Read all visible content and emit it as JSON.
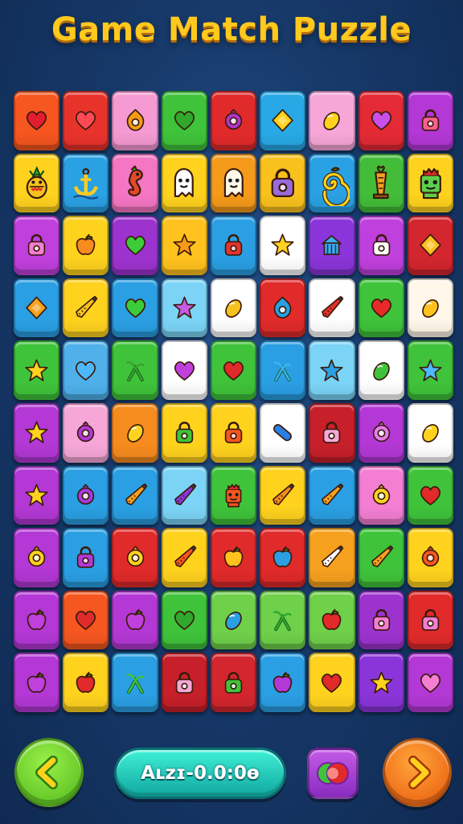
{
  "title": "Game Match Puzzle",
  "board": {
    "rows": [
      [
        {
          "color": "#f6561f",
          "icon": "heart",
          "fg": "#e21d2e"
        },
        {
          "color": "#e8332b",
          "icon": "heart",
          "fg": "#ff4a55"
        },
        {
          "color": "#f59ad2",
          "icon": "ring-flame",
          "fg": "#f49a15"
        },
        {
          "color": "#3fc33a",
          "icon": "heart",
          "fg": "#2fa82d"
        },
        {
          "color": "#e12a2a",
          "icon": "ring",
          "fg": "#b035c9"
        },
        {
          "color": "#28a9e5",
          "icon": "diamond",
          "fg": "#ffd21e"
        },
        {
          "color": "#f6a7d8",
          "icon": "lemon",
          "fg": "#ffd21e"
        },
        {
          "color": "#e32a35",
          "icon": "heart",
          "fg": "#c94fe8"
        },
        {
          "color": "#b338d5",
          "icon": "lock",
          "fg": "#ff5f8e"
        }
      ],
      [
        {
          "color": "#ffd21e",
          "icon": "pineapple",
          "fg": "#4caf50",
          "tall": true
        },
        {
          "color": "#2aa1e3",
          "icon": "anchor",
          "fg": "#ffcc1e",
          "tall": true
        },
        {
          "color": "#f576c2",
          "icon": "seahorse",
          "fg": "#e24a2a",
          "tall": true
        },
        {
          "color": "#ffd21e",
          "icon": "ghost",
          "fg": "#ffffff",
          "tall": true
        },
        {
          "color": "#f59a1a",
          "icon": "ghost",
          "fg": "#fff7e8",
          "tall": true
        },
        {
          "color": "#f9c11e",
          "icon": "lock",
          "fg": "#9a6ad8",
          "tall": true
        },
        {
          "color": "#2aa1e3",
          "icon": "spiral",
          "fg": "#ffd21e",
          "tall": true
        },
        {
          "color": "#43bd39",
          "icon": "torch",
          "fg": "#f6a11e",
          "tall": true
        },
        {
          "color": "#ffd21e",
          "icon": "robot",
          "fg": "#5dcf4a",
          "tall": true
        }
      ],
      [
        {
          "color": "#c040dd",
          "icon": "lock",
          "fg": "#f47ed2"
        },
        {
          "color": "#ffd21e",
          "icon": "apple",
          "fg": "#f68b1e"
        },
        {
          "color": "#9d33cf",
          "icon": "heart",
          "fg": "#3ccc3a"
        },
        {
          "color": "#ffc21e",
          "icon": "star",
          "fg": "#f79a1a"
        },
        {
          "color": "#2a9fe3",
          "icon": "lock",
          "fg": "#e6332b"
        },
        {
          "color": "#ffffff",
          "icon": "star",
          "fg": "#ffd21e"
        },
        {
          "color": "#8a35d9",
          "icon": "house",
          "fg": "#3ab0f0"
        },
        {
          "color": "#c040dd",
          "icon": "lock",
          "fg": "#ffffff"
        },
        {
          "color": "#d4262e",
          "icon": "diamond",
          "fg": "#ffc01e"
        }
      ],
      [
        {
          "color": "#2a9fe3",
          "icon": "diamond",
          "fg": "#f6a11e"
        },
        {
          "color": "#ffd21e",
          "icon": "carrot",
          "fg": "#f6c21e"
        },
        {
          "color": "#2a9fe3",
          "icon": "heart",
          "fg": "#3ccc3a"
        },
        {
          "color": "#7bd4f6",
          "icon": "star",
          "fg": "#c65ae3"
        },
        {
          "color": "#ffffff",
          "icon": "lemon",
          "fg": "#f8c21e"
        },
        {
          "color": "#e12a2a",
          "icon": "ring-flame",
          "fg": "#2a9fe3"
        },
        {
          "color": "#ffffff",
          "icon": "carrot",
          "fg": "#e1332b"
        },
        {
          "color": "#3fc33a",
          "icon": "heart",
          "fg": "#e62a2a"
        },
        {
          "color": "#fff8ea",
          "icon": "lemon",
          "fg": "#ffc21e"
        }
      ],
      [
        {
          "color": "#3fc33a",
          "icon": "star",
          "fg": "#ffd21e"
        },
        {
          "color": "#4fb0ea",
          "icon": "heart",
          "fg": "#4eb8ff"
        },
        {
          "color": "#3fc33a",
          "icon": "sprout",
          "fg": "#38a32f"
        },
        {
          "color": "#ffffff",
          "icon": "heart",
          "fg": "#c040dd"
        },
        {
          "color": "#3fc33a",
          "icon": "heart",
          "fg": "#e12a2a"
        },
        {
          "color": "#2a9fe3",
          "icon": "sprout",
          "fg": "#3ab5f4"
        },
        {
          "color": "#7bd4f6",
          "icon": "star",
          "fg": "#2a9fe3"
        },
        {
          "color": "#ffffff",
          "icon": "lemon",
          "fg": "#3fc33a"
        },
        {
          "color": "#3fc33a",
          "icon": "star",
          "fg": "#4eb8ff"
        }
      ],
      [
        {
          "color": "#b338d5",
          "icon": "star",
          "fg": "#ffd21e"
        },
        {
          "color": "#f6a7d8",
          "icon": "ring",
          "fg": "#b338d5"
        },
        {
          "color": "#f68b1e",
          "icon": "lemon",
          "fg": "#ffd21e"
        },
        {
          "color": "#ffd21e",
          "icon": "lock",
          "fg": "#3fc33a"
        },
        {
          "color": "#ffd21e",
          "icon": "lock",
          "fg": "#f6561f"
        },
        {
          "color": "#ffffff",
          "icon": "pill",
          "fg": "#2a7fe3"
        },
        {
          "color": "#c7202a",
          "icon": "lock",
          "fg": "#f6a7d8"
        },
        {
          "color": "#b338d5",
          "icon": "ring",
          "fg": "#e67cf0"
        },
        {
          "color": "#ffffff",
          "icon": "lemon",
          "fg": "#ffd21e"
        }
      ],
      [
        {
          "color": "#b338d5",
          "icon": "star",
          "fg": "#ffd21e"
        },
        {
          "color": "#2a9fe3",
          "icon": "ring",
          "fg": "#a53be0"
        },
        {
          "color": "#2a9fe3",
          "icon": "carrot",
          "fg": "#f6a11e"
        },
        {
          "color": "#7bd4f6",
          "icon": "carrot",
          "fg": "#8a35d9"
        },
        {
          "color": "#3fc33a",
          "icon": "robot",
          "fg": "#f6561f"
        },
        {
          "color": "#ffd21e",
          "icon": "carrot",
          "fg": "#f68b1e"
        },
        {
          "color": "#2a9fe3",
          "icon": "carrot",
          "fg": "#f6a11e"
        },
        {
          "color": "#f47ed2",
          "icon": "ring",
          "fg": "#ffd21e"
        },
        {
          "color": "#3fc33a",
          "icon": "heart",
          "fg": "#e12a2a"
        }
      ],
      [
        {
          "color": "#b338d5",
          "icon": "ring",
          "fg": "#ffd21e"
        },
        {
          "color": "#2a9fe3",
          "icon": "lock",
          "fg": "#b338d5"
        },
        {
          "color": "#e12a2a",
          "icon": "ring",
          "fg": "#ffd21e"
        },
        {
          "color": "#ffd21e",
          "icon": "carrot",
          "fg": "#f6561f"
        },
        {
          "color": "#e12a2a",
          "icon": "apple",
          "fg": "#ffc21e"
        },
        {
          "color": "#e12a2a",
          "icon": "apple",
          "fg": "#2a9fe3"
        },
        {
          "color": "#f6a11e",
          "icon": "carrot",
          "fg": "#ffffff"
        },
        {
          "color": "#3fc33a",
          "icon": "carrot",
          "fg": "#f6a11e"
        },
        {
          "color": "#ffd21e",
          "icon": "ring",
          "fg": "#f6561f"
        }
      ],
      [
        {
          "color": "#b338d5",
          "icon": "apple",
          "fg": "#c040dd"
        },
        {
          "color": "#f6561f",
          "icon": "heart",
          "fg": "#e12a2a"
        },
        {
          "color": "#b338d5",
          "icon": "apple",
          "fg": "#c040dd"
        },
        {
          "color": "#3fc33a",
          "icon": "heart",
          "fg": "#2fa82d"
        },
        {
          "color": "#6fd04a",
          "icon": "lemon",
          "fg": "#2a9fe3"
        },
        {
          "color": "#6fd04a",
          "icon": "sprout",
          "fg": "#2fa82d"
        },
        {
          "color": "#6fd04a",
          "icon": "apple",
          "fg": "#e12a2a"
        },
        {
          "color": "#9d33cf",
          "icon": "lock",
          "fg": "#f47ed2"
        },
        {
          "color": "#e12a2a",
          "icon": "lock",
          "fg": "#f47ed2"
        }
      ],
      [
        {
          "color": "#b338d5",
          "icon": "apple",
          "fg": "#c040dd"
        },
        {
          "color": "#ffd21e",
          "icon": "apple",
          "fg": "#e12a2a"
        },
        {
          "color": "#2a9fe3",
          "icon": "sprout",
          "fg": "#3fc33a"
        },
        {
          "color": "#c7202a",
          "icon": "lock",
          "fg": "#f6a7d8"
        },
        {
          "color": "#d4262e",
          "icon": "lock",
          "fg": "#3fc33a"
        },
        {
          "color": "#2a9fe3",
          "icon": "apple",
          "fg": "#b338d5"
        },
        {
          "color": "#ffd21e",
          "icon": "heart",
          "fg": "#e12a2a"
        },
        {
          "color": "#8a35d9",
          "icon": "star",
          "fg": "#ffd21e"
        },
        {
          "color": "#b338d5",
          "icon": "heart",
          "fg": "#f47ed2"
        }
      ]
    ]
  },
  "controls": {
    "back_icon": "back-arrow-icon",
    "timer_text": "Aʟzɪ-0.0:0ɵ",
    "swap_icon": "swap-icon",
    "next_icon": "next-arrow-icon"
  }
}
